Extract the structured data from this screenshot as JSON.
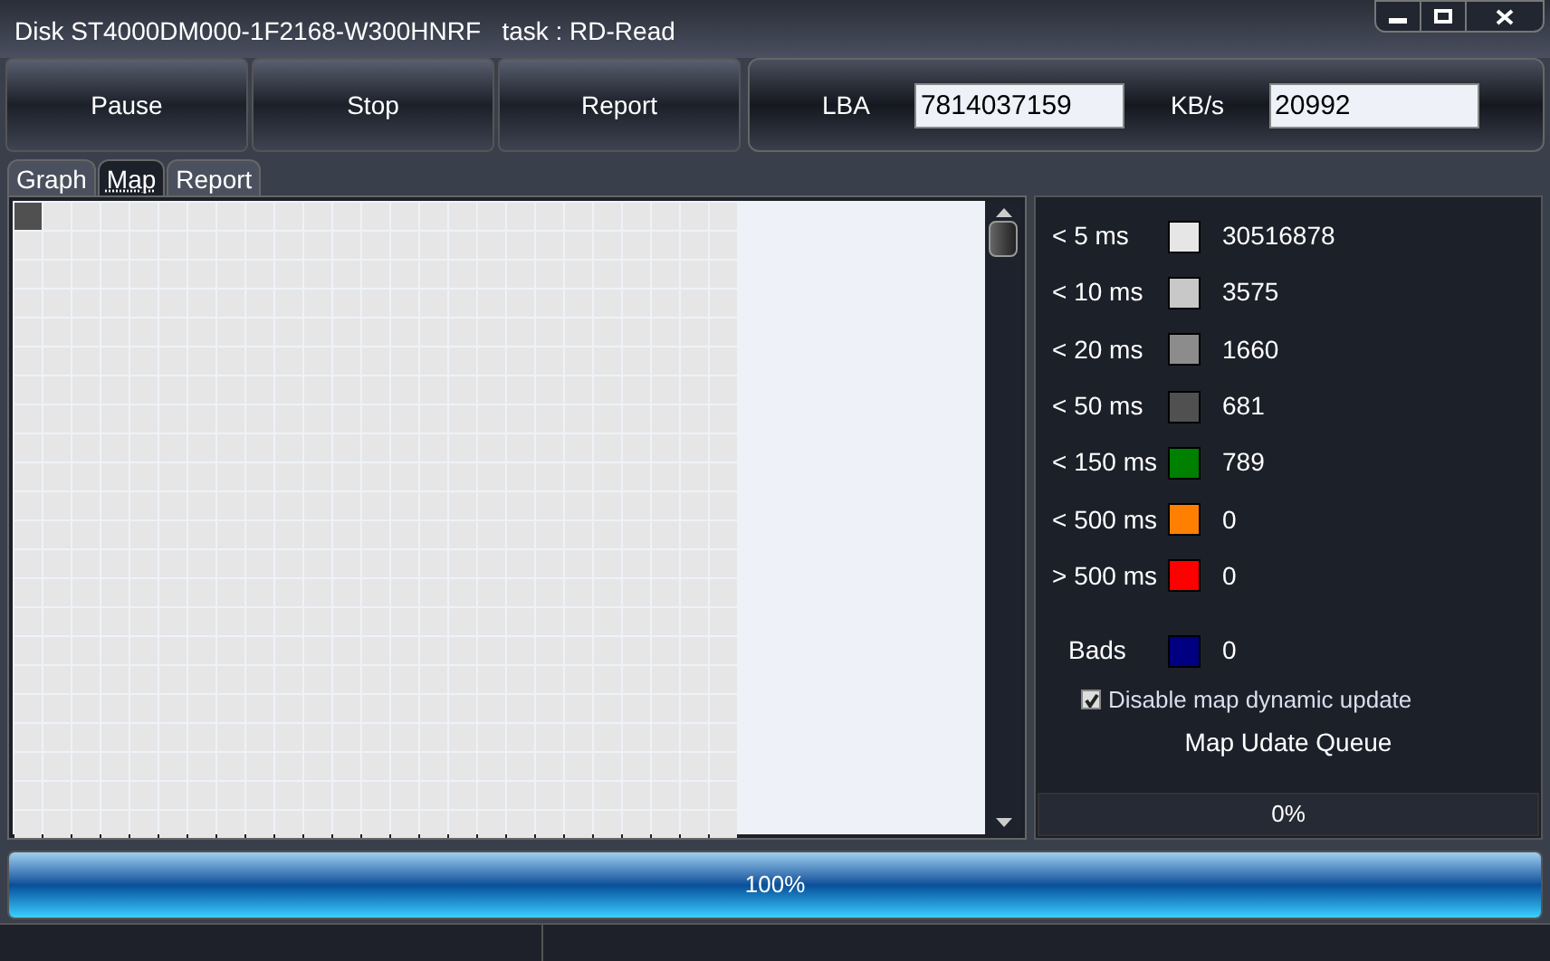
{
  "window": {
    "title": "Disk ST4000DM000-1F2168-W300HNRF   task : RD-Read"
  },
  "toolbar": {
    "buttons": [
      "Pause",
      "Stop",
      "Report"
    ],
    "fields": [
      {
        "label": "LBA",
        "value": "7814037159"
      },
      {
        "label": "KB/s",
        "value": "20992"
      }
    ]
  },
  "tabs": [
    {
      "label": "Graph",
      "selected": false
    },
    {
      "label": "Map",
      "selected": true
    },
    {
      "label": "Report",
      "selected": false
    }
  ],
  "legend": [
    {
      "label": "< 5 ms",
      "color": "#e6e6e6",
      "count": "30516878"
    },
    {
      "label": "< 10 ms",
      "color": "#c8c8c8",
      "count": "3575"
    },
    {
      "label": "< 20 ms",
      "color": "#8c8c8c",
      "count": "1660"
    },
    {
      "label": "< 50 ms",
      "color": "#505050",
      "count": "681"
    },
    {
      "label": "< 150 ms",
      "color": "#008000",
      "count": "789"
    },
    {
      "label": "< 500 ms",
      "color": "#ff8000",
      "count": "0"
    },
    {
      "label": "> 500 ms",
      "color": "#ff0000",
      "count": "0"
    }
  ],
  "bads": {
    "label": "Bads",
    "color": "#000080",
    "count": "0"
  },
  "disable_map_update": {
    "label": "Disable map dynamic update",
    "checked": true
  },
  "queue": {
    "title": "Map Udate Queue",
    "reading": "0%",
    "level": 0
  },
  "progress": {
    "reading": "100%",
    "level": 1
  }
}
